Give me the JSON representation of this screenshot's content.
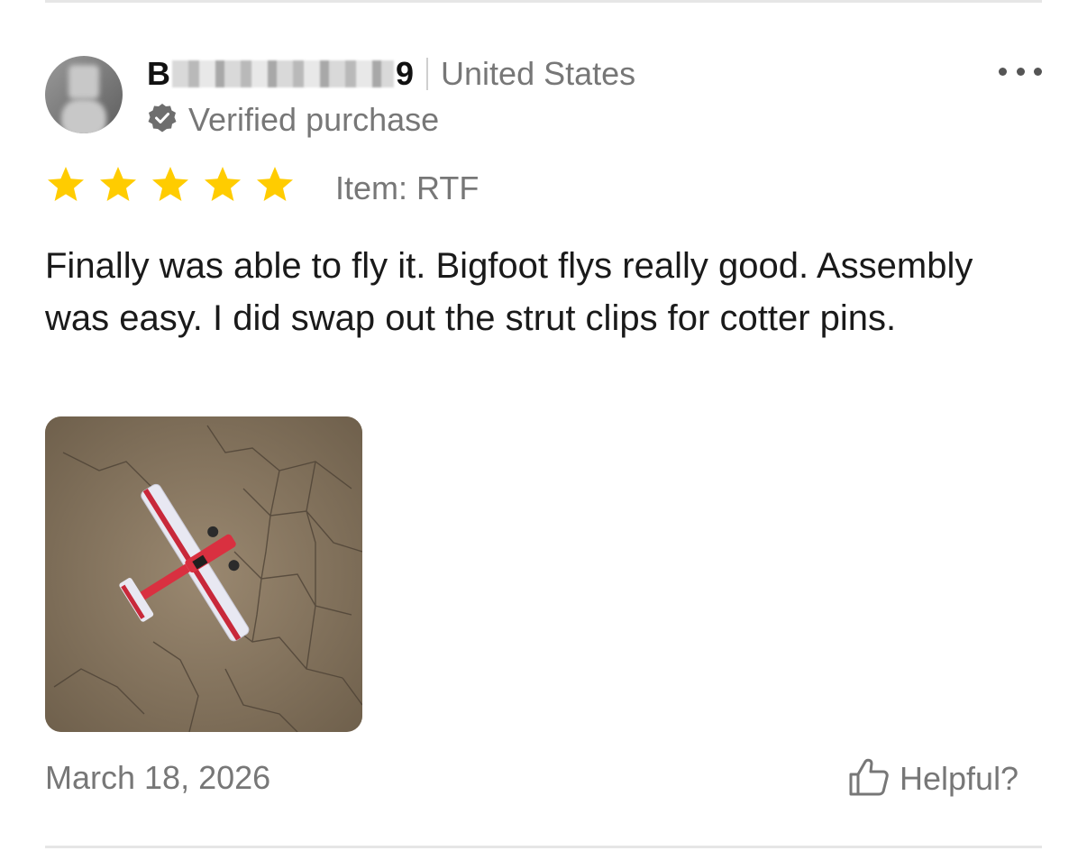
{
  "review": {
    "username_first": "B",
    "username_last": "9",
    "country": "United States",
    "verified_label": "Verified purchase",
    "rating": 5,
    "rating_max": 5,
    "item_label": "Item: RTF",
    "text": "Finally was able to fly it. Bigfoot flys really good. Assembly was easy. I did swap out the strut clips for cotter pins.",
    "date": "March 18, 2026",
    "helpful_label": "Helpful?"
  },
  "colors": {
    "star": "#ffcc00",
    "muted_text": "#777777",
    "divider": "#e6e6e6",
    "badge": "#6e6e6e"
  },
  "icons": {
    "more": "more-options-icon",
    "verified": "verified-badge-icon",
    "star": "star-icon",
    "helpful": "thumbs-up-icon"
  }
}
